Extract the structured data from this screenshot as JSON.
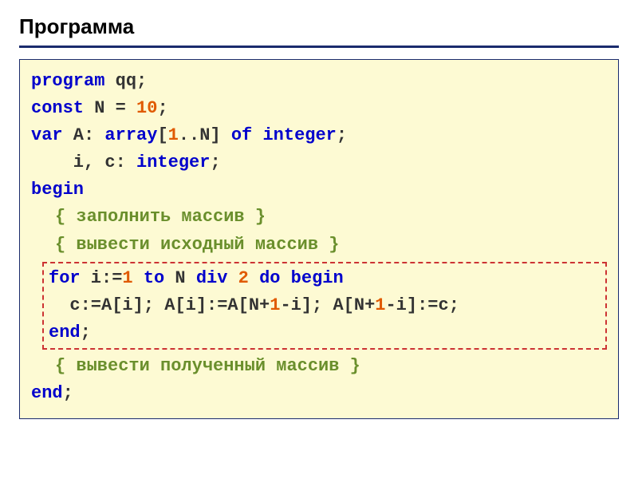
{
  "header": {
    "title": "Программа"
  },
  "code": {
    "l1_kw": "program",
    "l1_rest": " qq;",
    "l2_kw": "const",
    "l2_rest": " N = ",
    "l2_num": "10",
    "l2_semi": ";",
    "l3_kw": "var",
    "l3_rest": " A: ",
    "l3_kw2": "array",
    "l3_mid": "[",
    "l3_num1": "1",
    "l3_dots": "..N] ",
    "l3_kw3": "of",
    "l3_space": " ",
    "l3_kw4": "integer",
    "l3_semi": ";",
    "l4_text": "    i, c: ",
    "l4_kw": "integer",
    "l4_semi": ";",
    "l5_kw": "begin",
    "l6_comm": "{ заполнить массив }",
    "l7_comm": "{ вывести исходный массив }",
    "l8_kw1": "for",
    "l8_a": " i:=",
    "l8_num1": "1",
    "l8_b": " ",
    "l8_kw2": "to",
    "l8_c": " N ",
    "l8_kw3": "div",
    "l8_d": " ",
    "l8_num2": "2",
    "l8_e": " ",
    "l8_kw4": "do",
    "l8_f": " ",
    "l8_kw5": "begin",
    "l9_a": "  c:=A[i]; A[i]:=A[N+",
    "l9_n1": "1",
    "l9_b": "-i]; A[N+",
    "l9_n2": "1",
    "l9_c": "-i]:=c;",
    "l10_kw": "end",
    "l10_semi": ";",
    "l11_comm": "{ вывести полученный массив }",
    "l12_kw": "end",
    "l12_semi": ";"
  }
}
